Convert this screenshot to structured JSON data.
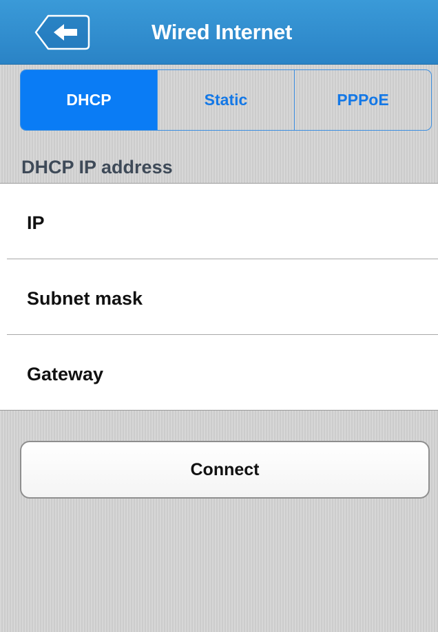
{
  "header": {
    "title": "Wired Internet",
    "back_icon": "back-arrow-icon",
    "color": "#2f8fd2"
  },
  "tabs": [
    {
      "label": "DHCP",
      "active": true
    },
    {
      "label": "Static",
      "active": false
    },
    {
      "label": "PPPoE",
      "active": false
    }
  ],
  "accent_color": "#0a7cf5",
  "section": {
    "title": "DHCP IP address"
  },
  "fields": [
    {
      "label": "IP",
      "value": ""
    },
    {
      "label": "Subnet mask",
      "value": ""
    },
    {
      "label": "Gateway",
      "value": ""
    }
  ],
  "actions": {
    "connect_label": "Connect"
  }
}
